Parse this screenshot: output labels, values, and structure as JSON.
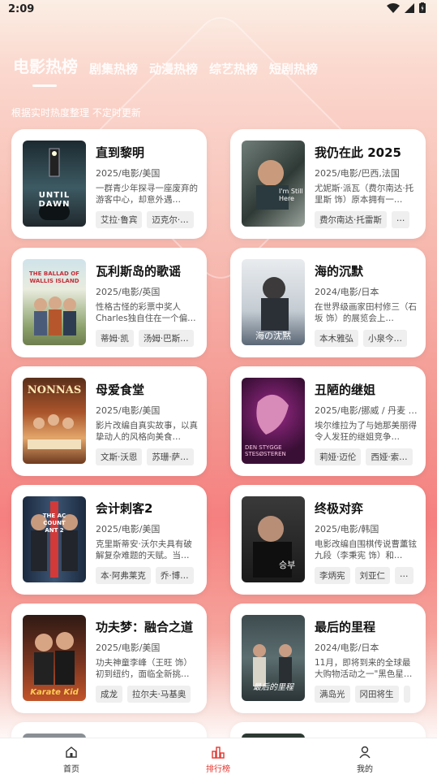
{
  "status_bar": {
    "time": "2:09"
  },
  "tabs": [
    {
      "label": "电影热榜",
      "active": true
    },
    {
      "label": "剧集热榜"
    },
    {
      "label": "动漫热榜"
    },
    {
      "label": "综艺热榜"
    },
    {
      "label": "短剧热榜"
    }
  ],
  "subtitle": "根据实时热度整理 不定时更新",
  "cards": [
    {
      "title": "直到黎明",
      "meta": "2025/电影/美国",
      "desc": "一群青少年探寻一座废弃的游客中心，却意外遇…",
      "chips": [
        "艾拉·鲁宾",
        "迈克尔·…"
      ],
      "poster_text": "UNTIL DAWN"
    },
    {
      "title": "我仍在此 2025",
      "meta": "2025/电影/巴西,法国",
      "desc": "尤妮斯·派瓦（费尔南达·托里斯 饰）原本拥有一…",
      "chips": [
        "费尔南达·托雷斯",
        "…"
      ],
      "poster_text": "I'm Still Here"
    },
    {
      "title": "瓦利斯岛的歌谣",
      "meta": "2025/电影/英国",
      "desc": "性格古怪的彩票中奖人Charles独自住在一个偏…",
      "chips": [
        "蒂姆·凯",
        "汤姆·巴斯…"
      ],
      "poster_text": "THE BALLAD OF WALLIS ISLAND"
    },
    {
      "title": "海的沉默",
      "meta": "2024/电影/日本",
      "desc": "在世界级画家田村修三（石坂 饰）的展览会上…",
      "chips": [
        "本木雅弘",
        "小泉今…"
      ],
      "poster_text": "海の沈黙"
    },
    {
      "title": "母爱食堂",
      "meta": "2025/电影/美国",
      "desc": "影片改编自真实故事，以真挚动人的风格向美食…",
      "chips": [
        "文斯·沃恩",
        "苏珊·萨…"
      ],
      "poster_text": "NONNAS"
    },
    {
      "title": "丑陋的继姐",
      "meta": "2025/电影/挪威 / 丹麦 / …",
      "desc": "埃尔维拉为了与她那美丽得令人发狂的继姐竞争…",
      "chips": [
        "莉娅·迈伦",
        "西娅·索…"
      ],
      "poster_text": "DEN STYGGE STESØSTEREN"
    },
    {
      "title": "会计刺客2",
      "meta": "2025/电影/美国",
      "desc": "克里斯蒂安·沃尔夫具有破解复杂难题的天赋。当…",
      "chips": [
        "本·阿弗莱克",
        "乔·博…"
      ],
      "poster_text": "THE ACCOUNTANT 2"
    },
    {
      "title": "终极对弈",
      "meta": "2025/电影/韩国",
      "desc": "电影改编自围棋传说曹薰铉九段（李秉宪 饰）和…",
      "chips": [
        "李炳宪",
        "刘亚仁",
        "…"
      ],
      "poster_text": "승부"
    },
    {
      "title": "功夫梦：融合之道",
      "meta": "2025/电影/美国",
      "desc": "功夫神童李峰（王旺 饰）初到纽约，面临全新挑…",
      "chips": [
        "成龙",
        "拉尔夫·马基奥"
      ],
      "poster_text": "Karate Kid"
    },
    {
      "title": "最后的里程",
      "meta": "2024/电影/日本",
      "desc": "11月，即将到来的全球最大购物活动之一\"黑色星…",
      "chips": [
        "满岛光",
        "冈田将生",
        ""
      ],
      "poster_text": "最后的里程"
    }
  ],
  "bottom_nav": [
    {
      "label": "首页",
      "icon": "home-icon"
    },
    {
      "label": "排行榜",
      "icon": "chart-icon",
      "active": true
    },
    {
      "label": "我的",
      "icon": "user-icon"
    }
  ],
  "colors": {
    "accent": "#e3362f",
    "card_bg": "#ffffff"
  }
}
